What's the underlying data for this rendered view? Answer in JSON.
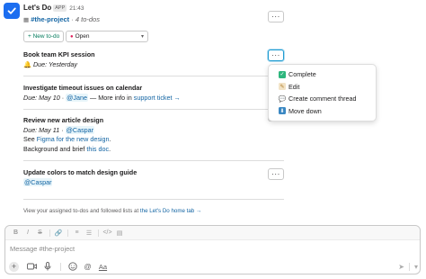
{
  "header": {
    "app_name": "Let's Do",
    "app_badge": "APP",
    "time": "21:43",
    "channel": "#the-project",
    "todo_count": "· 4 to-dos"
  },
  "controls": {
    "new_todo": "+ New to-do",
    "filter_value": "Open"
  },
  "tasks": [
    {
      "title": "Book team KPI session",
      "due": "Due: Yesterday"
    },
    {
      "title": "Investigate timeout issues on calendar",
      "due": "Due: May 10",
      "assignee": "@Jane",
      "sep": " — More info in ",
      "link": "support ticket →"
    },
    {
      "title": "Review new article design",
      "due": "Due: May 11",
      "assignee": "@Caspar",
      "line2_pre": "See ",
      "line2_link": "Figma for the new design",
      "line2_post": ".",
      "line3_pre": "Background and brief ",
      "line3_link": "this doc",
      "line3_post": "."
    },
    {
      "title": "Update colors to match design guide",
      "assignee": "@Caspar"
    }
  ],
  "footer": {
    "text": "View your assigned to-dos and followed lists at ",
    "link": "the Let's Do home tab →"
  },
  "menu": {
    "items": [
      {
        "label": "Complete",
        "icon": "check-box-icon"
      },
      {
        "label": "Edit",
        "icon": "memo-icon"
      },
      {
        "label": "Create comment thread",
        "icon": "speech-bubble-icon"
      },
      {
        "label": "Move down",
        "icon": "down-arrow-box-icon"
      }
    ]
  },
  "composer": {
    "placeholder": "Message #the-project",
    "format_buttons": [
      "B",
      "I",
      "S",
      "</>",
      "⊘",
      "≡",
      "☰",
      "</>",
      "▤"
    ],
    "bottom_buttons": [
      "Aa"
    ]
  },
  "colors": {
    "link": "#1264a3",
    "green": "#007a5a",
    "app_icon": "#1c6ef0"
  }
}
